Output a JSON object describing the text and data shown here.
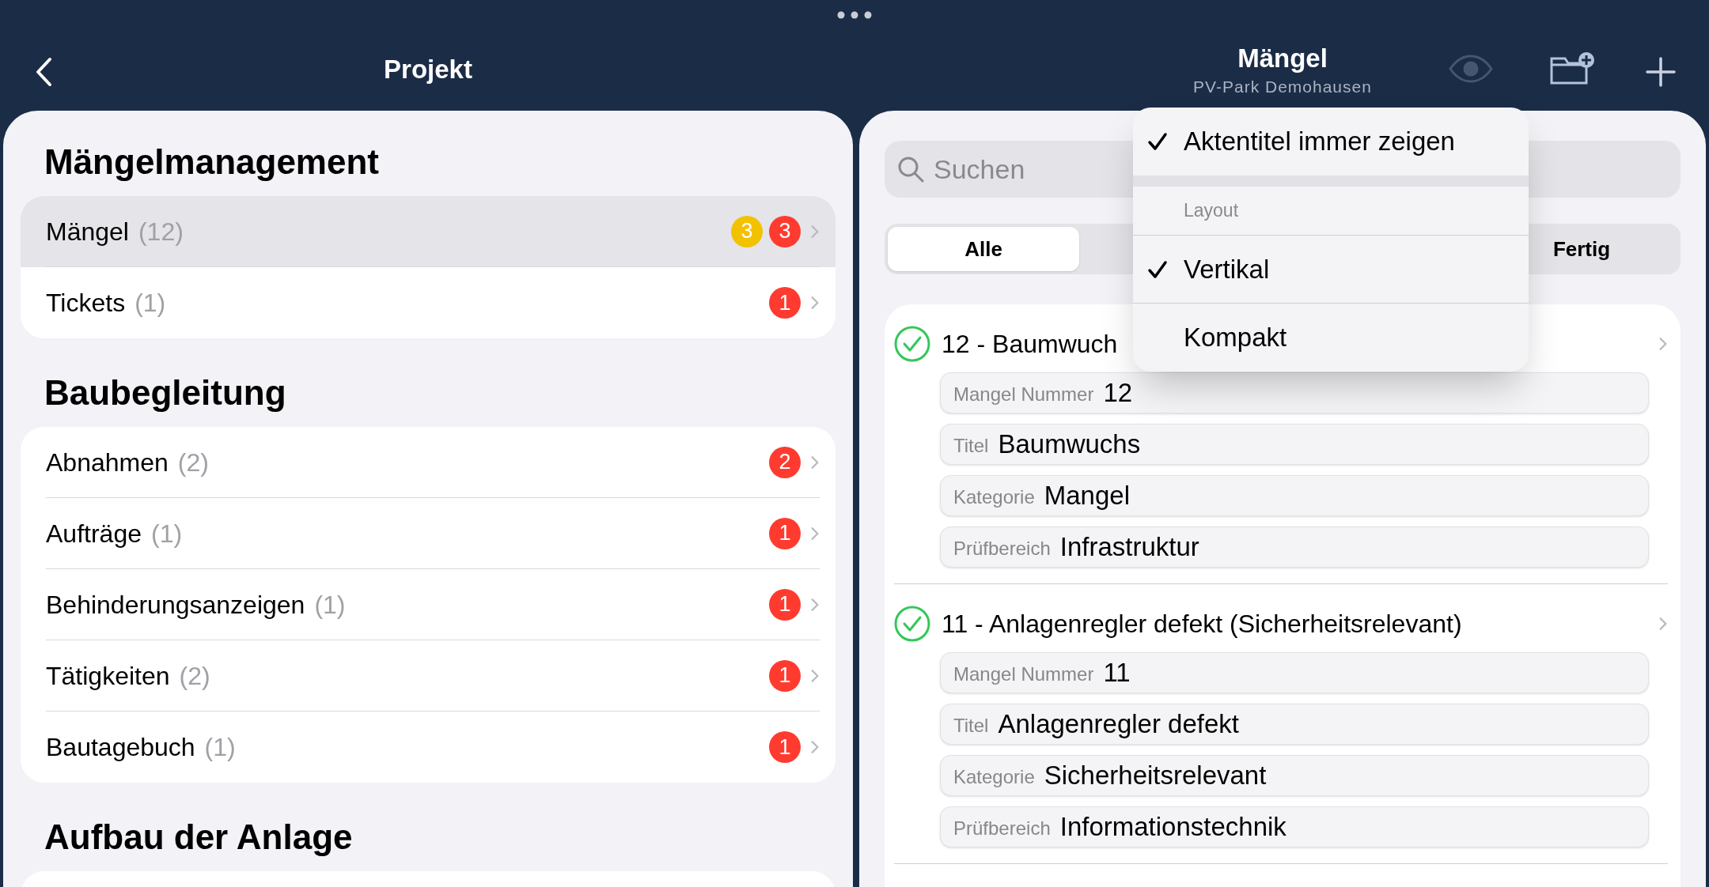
{
  "left": {
    "title": "Projekt",
    "sections": [
      {
        "title": "Mängelmanagement",
        "items": [
          {
            "label": "Mängel",
            "count": "(12)",
            "selected": true,
            "badges": [
              {
                "text": "3",
                "color": "#f2c200"
              },
              {
                "text": "3",
                "color": "#ff3b30"
              }
            ]
          },
          {
            "label": "Tickets",
            "count": "(1)",
            "selected": false,
            "badges": [
              {
                "text": "1",
                "color": "#ff3b30"
              }
            ]
          }
        ]
      },
      {
        "title": "Baubegleitung",
        "items": [
          {
            "label": "Abnahmen",
            "count": "(2)",
            "selected": false,
            "badges": [
              {
                "text": "2",
                "color": "#ff3b30"
              }
            ]
          },
          {
            "label": "Aufträge",
            "count": "(1)",
            "selected": false,
            "badges": [
              {
                "text": "1",
                "color": "#ff3b30"
              }
            ]
          },
          {
            "label": "Behinderungsanzeigen",
            "count": "(1)",
            "selected": false,
            "badges": [
              {
                "text": "1",
                "color": "#ff3b30"
              }
            ]
          },
          {
            "label": "Tätigkeiten",
            "count": "(2)",
            "selected": false,
            "badges": [
              {
                "text": "1",
                "color": "#ff3b30"
              }
            ]
          },
          {
            "label": "Bautagebuch",
            "count": "(1)",
            "selected": false,
            "badges": [
              {
                "text": "1",
                "color": "#ff3b30"
              }
            ]
          }
        ]
      },
      {
        "title": "Aufbau der Anlage"
      }
    ]
  },
  "right": {
    "title": "Mängel",
    "subtitle": "PV-Park Demohausen",
    "eye_button": {
      "disabled": true
    },
    "search": {
      "placeholder": "Suchen"
    },
    "segments": [
      {
        "label": "Alle",
        "selected": true
      },
      {
        "label": "Fertig",
        "selected": false
      }
    ],
    "items": [
      {
        "title": "12 - Baumwuch",
        "done": true,
        "fields": [
          {
            "label": "Mangel Nummer",
            "value": "12"
          },
          {
            "label": "Titel",
            "value": "Baumwuchs"
          },
          {
            "label": "Kategorie",
            "value": "Mangel"
          },
          {
            "label": "Prüfbereich",
            "value": "Infrastruktur"
          }
        ]
      },
      {
        "title": "11 - Anlagenregler defekt (Sicherheitsrelevant)",
        "done": true,
        "fields": [
          {
            "label": "Mangel Nummer",
            "value": "11"
          },
          {
            "label": "Titel",
            "value": "Anlagenregler defekt"
          },
          {
            "label": "Kategorie",
            "value": "Sicherheitsrelevant"
          },
          {
            "label": "Prüfbereich",
            "value": "Informationstechnik"
          }
        ]
      }
    ]
  },
  "menu": {
    "items": [
      {
        "kind": "option",
        "label": "Aktentitel immer zeigen",
        "checked": true
      },
      {
        "kind": "separator"
      },
      {
        "kind": "header",
        "label": "Layout"
      },
      {
        "kind": "option",
        "label": "Vertikal",
        "checked": true
      },
      {
        "kind": "option",
        "label": "Kompakt",
        "checked": false
      }
    ]
  }
}
